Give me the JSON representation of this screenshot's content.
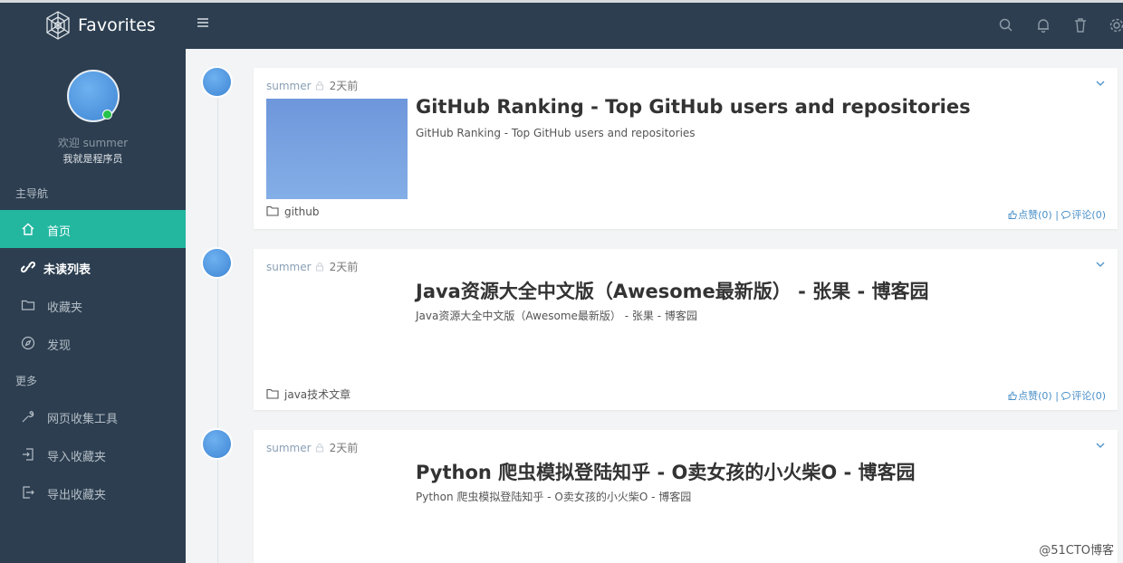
{
  "app": {
    "brand": "Favorites"
  },
  "user": {
    "welcome": "欢迎 summer",
    "motto": "我就是程序员"
  },
  "sidebar": {
    "section_main": "主导航",
    "main_items": [
      {
        "label": "首页",
        "icon": "home-icon",
        "active": true
      },
      {
        "label": "未读列表",
        "icon": "link-icon"
      },
      {
        "label": "收藏夹",
        "icon": "folder-icon"
      },
      {
        "label": "发现",
        "icon": "compass-icon"
      }
    ],
    "section_more": "更多",
    "more_items": [
      {
        "label": "网页收集工具",
        "icon": "wrench-icon"
      },
      {
        "label": "导入收藏夹",
        "icon": "import-icon"
      },
      {
        "label": "导出收藏夹",
        "icon": "export-icon"
      }
    ]
  },
  "topbar_icons": [
    "search-icon",
    "bell-icon",
    "trash-icon",
    "gear-icon"
  ],
  "cards": [
    {
      "user": "summer",
      "time": "2天前",
      "title": "GitHub Ranking - Top GitHub users and repositories",
      "desc": "GitHub Ranking - Top GitHub users and repositories",
      "folder": "github",
      "like": "点赞(0)",
      "sep": "|",
      "comment": "评论(0)"
    },
    {
      "user": "summer",
      "time": "2天前",
      "title": "Java资源大全中文版（Awesome最新版） - 张果 - 博客园",
      "desc": "Java资源大全中文版（Awesome最新版） - 张果 - 博客园",
      "folder": "java技术文章",
      "like": "点赞(0)",
      "sep": "|",
      "comment": "评论(0)"
    },
    {
      "user": "summer",
      "time": "2天前",
      "title": "Python 爬虫模拟登陆知乎 - O卖女孩的小火柴O - 博客园",
      "desc": "Python 爬虫模拟登陆知乎 - O卖女孩的小火柴O - 博客园"
    }
  ],
  "watermark": "@51CTO博客",
  "colors": {
    "topbar": "#2c3e50",
    "sidebar": "#2c3e50",
    "active": "#23b7a0",
    "background": "#f2f4f5"
  }
}
